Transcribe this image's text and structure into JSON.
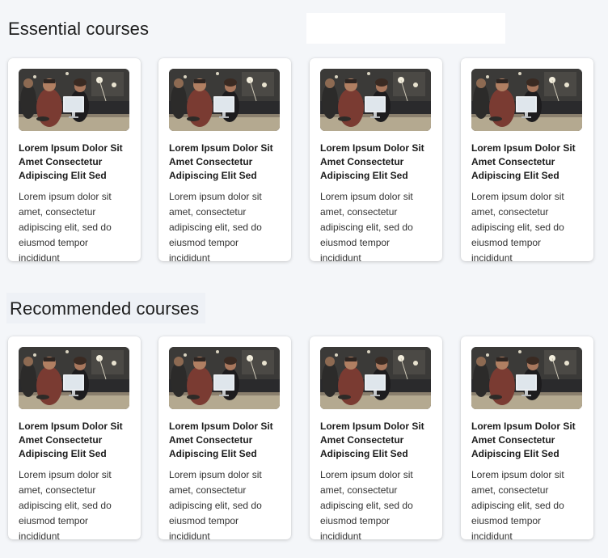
{
  "sections": [
    {
      "title": "Essential courses",
      "cards": [
        {
          "title": "Lorem Ipsum Dolor Sit Amet Consectetur Adipiscing Elit Sed",
          "description": "Lorem ipsum dolor sit amet, consectetur adipiscing elit, sed do eiusmod tempor incididunt"
        },
        {
          "title": "Lorem Ipsum Dolor Sit Amet Consectetur Adipiscing Elit Sed",
          "description": "Lorem ipsum dolor sit amet, consectetur adipiscing elit, sed do eiusmod tempor incididunt"
        },
        {
          "title": "Lorem Ipsum Dolor Sit Amet Consectetur Adipiscing Elit Sed",
          "description": "Lorem ipsum dolor sit amet, consectetur adipiscing elit, sed do eiusmod tempor incididunt"
        },
        {
          "title": "Lorem Ipsum Dolor Sit Amet Consectetur Adipiscing Elit Sed",
          "description": "Lorem ipsum dolor sit amet, consectetur adipiscing elit, sed do eiusmod tempor incididunt"
        }
      ]
    },
    {
      "title": "Recommended courses",
      "cards": [
        {
          "title": "Lorem Ipsum Dolor Sit Amet Consectetur Adipiscing Elit Sed",
          "description": "Lorem ipsum dolor sit amet, consectetur adipiscing elit, sed do eiusmod tempor incididunt"
        },
        {
          "title": "Lorem Ipsum Dolor Sit Amet Consectetur Adipiscing Elit Sed",
          "description": "Lorem ipsum dolor sit amet, consectetur adipiscing elit, sed do eiusmod tempor incididunt"
        },
        {
          "title": "Lorem Ipsum Dolor Sit Amet Consectetur Adipiscing Elit Sed",
          "description": "Lorem ipsum dolor sit amet, consectetur adipiscing elit, sed do eiusmod tempor incididunt"
        },
        {
          "title": "Lorem Ipsum Dolor Sit Amet Consectetur Adipiscing Elit Sed",
          "description": "Lorem ipsum dolor sit amet, consectetur adipiscing elit, sed do eiusmod tempor incididunt"
        }
      ]
    }
  ],
  "theme": {
    "background": "#f4f6f9",
    "card_background": "#ffffff",
    "text_color": "#1b1b1b"
  }
}
